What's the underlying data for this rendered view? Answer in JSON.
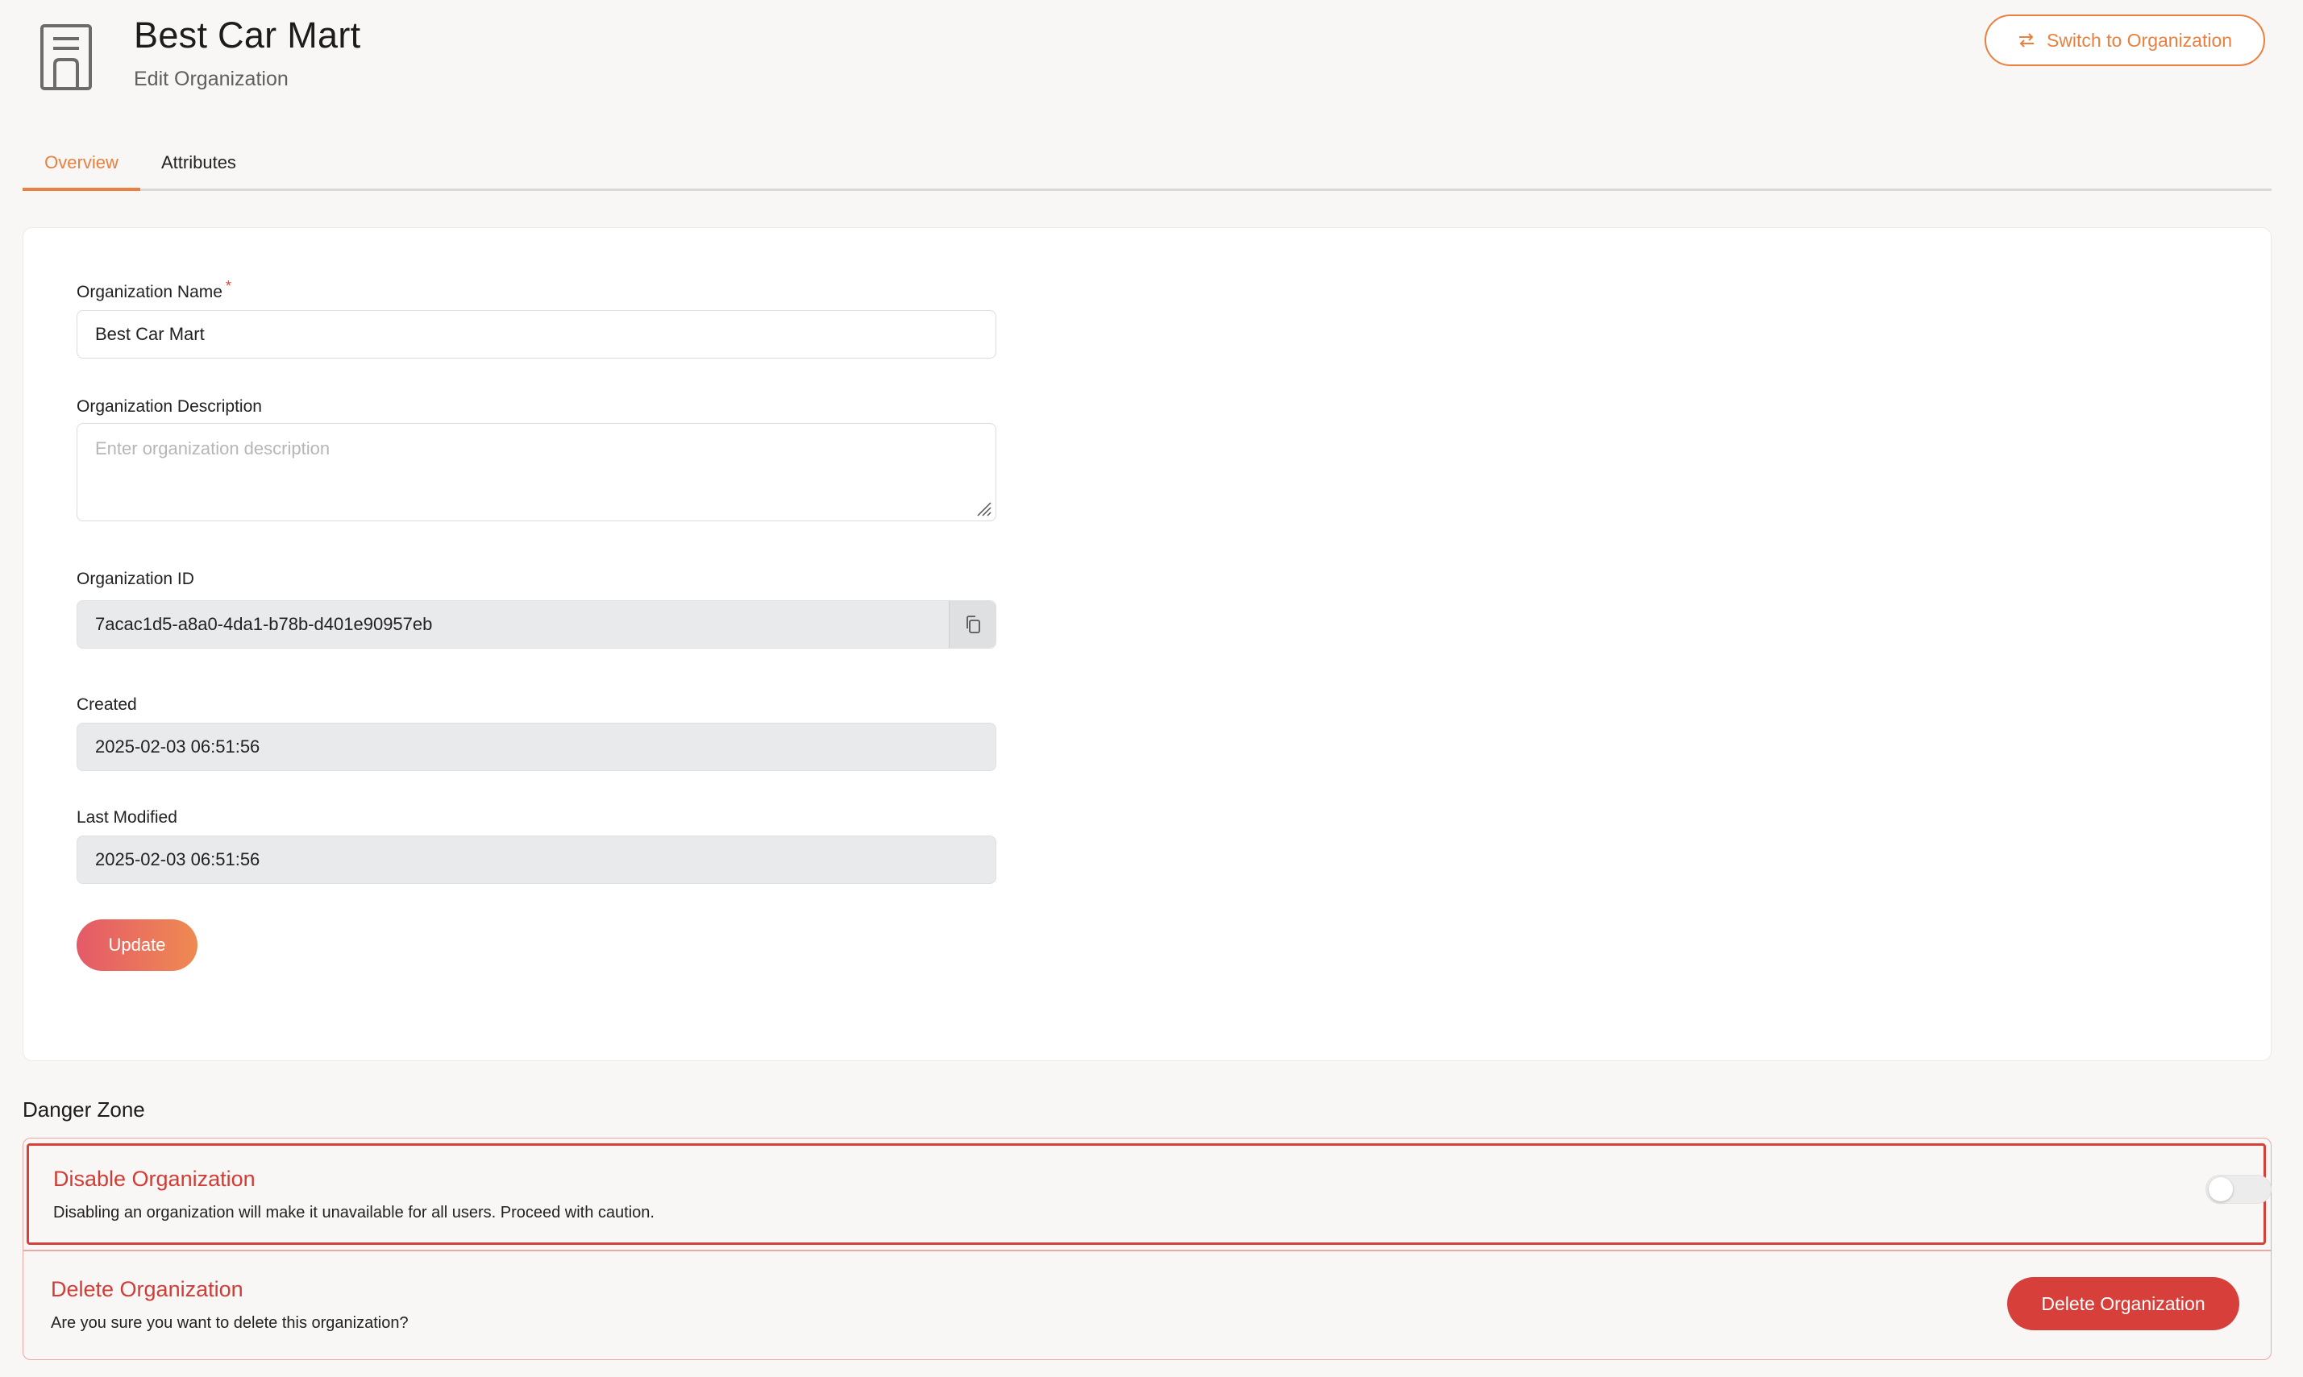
{
  "header": {
    "title": "Best Car Mart",
    "subtitle": "Edit Organization",
    "switch_button_label": "Switch to Organization",
    "org_icon": "building-icon",
    "switch_icon": "swap-arrows-icon"
  },
  "tabs": [
    {
      "label": "Overview",
      "active": true
    },
    {
      "label": "Attributes",
      "active": false
    }
  ],
  "form": {
    "name": {
      "label": "Organization Name",
      "required_marker": "*",
      "value": "Best Car Mart"
    },
    "description": {
      "label": "Organization Description",
      "value": "",
      "placeholder": "Enter organization description"
    },
    "id": {
      "label": "Organization ID",
      "value": "7acac1d5-a8a0-4da1-b78b-d401e90957eb",
      "copy_icon": "copy-icon"
    },
    "created": {
      "label": "Created",
      "value": "2025-02-03 06:51:56"
    },
    "last_modified": {
      "label": "Last Modified",
      "value": "2025-02-03 06:51:56"
    },
    "update_label": "Update"
  },
  "danger_zone": {
    "heading": "Danger Zone",
    "disable": {
      "title": "Disable Organization",
      "description": "Disabling an organization will make it unavailable for all users. Proceed with caution.",
      "toggle_on": false
    },
    "delete": {
      "title": "Delete Organization",
      "description": "Are you sure you want to delete this organization?",
      "button_label": "Delete Organization"
    }
  },
  "colors": {
    "accent": "#e9803f",
    "danger": "#d7403a",
    "page_bg": "#f8f7f5"
  }
}
